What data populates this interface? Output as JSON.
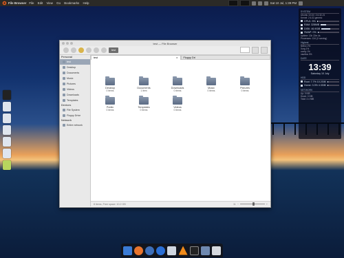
{
  "panel": {
    "app_name": "File Browser",
    "menu": [
      "File",
      "Edit",
      "View",
      "Go",
      "Bookmarks",
      "Help"
    ],
    "clock": "Sat 10 Jul, 1:39 PM"
  },
  "window": {
    "title": "test — File Browser",
    "path_button": "test",
    "tabs": [
      {
        "label": "test"
      },
      {
        "label": "Floppy Dri"
      }
    ],
    "tab_close": "✕",
    "sidebar": {
      "places_header": "Personal",
      "places": [
        "test",
        "Desktop",
        "Documents",
        "Music",
        "Pictures",
        "Videos",
        "Downloads",
        "Templates"
      ],
      "devices_header": "Devices",
      "devices": [
        "File System",
        "Floppy Drive"
      ],
      "network_header": "Network",
      "network": [
        "Entire network"
      ]
    },
    "files": [
      {
        "name": "Desktop",
        "count": "0 items"
      },
      {
        "name": "Documents",
        "count": "1 item"
      },
      {
        "name": "Downloads",
        "count": "0 items"
      },
      {
        "name": "Music",
        "count": "0 items"
      },
      {
        "name": "Pictures",
        "count": "0 items"
      },
      {
        "name": "Public",
        "count": "0 items"
      },
      {
        "name": "Templates",
        "count": "0 items"
      },
      {
        "name": "Videos",
        "count": "0 items"
      }
    ],
    "status_text": "8 items, Free space: 10.2 GB",
    "zoom_value": "11"
  },
  "conky": {
    "system_header": "SYSTEM",
    "system_lines": [
      "Ubuntu 10.04 / 2.6.32-21",
      "Kernel: 2.6.32-generic"
    ],
    "cpu_rows": [
      {
        "label": "CPU1: 5%",
        "level": 0.05
      },
      {
        "label": "RAM: 328MiB",
        "level": 0.3
      },
      {
        "label": "DISK: 46.9GiB",
        "level": 0.5
      },
      {
        "label": "SWAP: 0%",
        "level": 0.0
      }
    ],
    "info_rows": [
      "Uptime: 13h 22m 4s",
      "Processes: 134 (2 running)"
    ],
    "top_header": "Highest",
    "top_rows": [
      "firefox  2%",
      "Xorg  1%",
      "conky  1%",
      "nautilus  0%"
    ],
    "time_header": "DATE",
    "time": "13:39",
    "date": "Saturday 10 July",
    "hdd_header": "HDD",
    "hdd_rows": [
      {
        "label": "Root: 7.7%  10.2GiB",
        "level": 0.08
      },
      {
        "label": "Home: 3.3%  4.3GiB",
        "level": 0.03
      }
    ],
    "net_header": "NETWORK",
    "net_rows": [
      "Up: 0 KiB",
      "Down: 0 KiB",
      "Total: 2.4 MiB"
    ]
  },
  "colors": {
    "accent": "#9aa6b6",
    "panel_bg": "#2b2a27",
    "window_bg": "#f2f2f2"
  },
  "icons": {
    "left_dock": [
      "monitor-icon",
      "home-folder-icon",
      "document-icon",
      "document-icon",
      "document-icon",
      "document-icon",
      "trash-icon"
    ],
    "bottom_dock": [
      "files-icon",
      "firefox-icon",
      "thunderbird-icon",
      "deluge-icon",
      "pidgin-icon",
      "vlc-icon",
      "terminal-icon",
      "folder-icon",
      "trash-icon"
    ]
  }
}
